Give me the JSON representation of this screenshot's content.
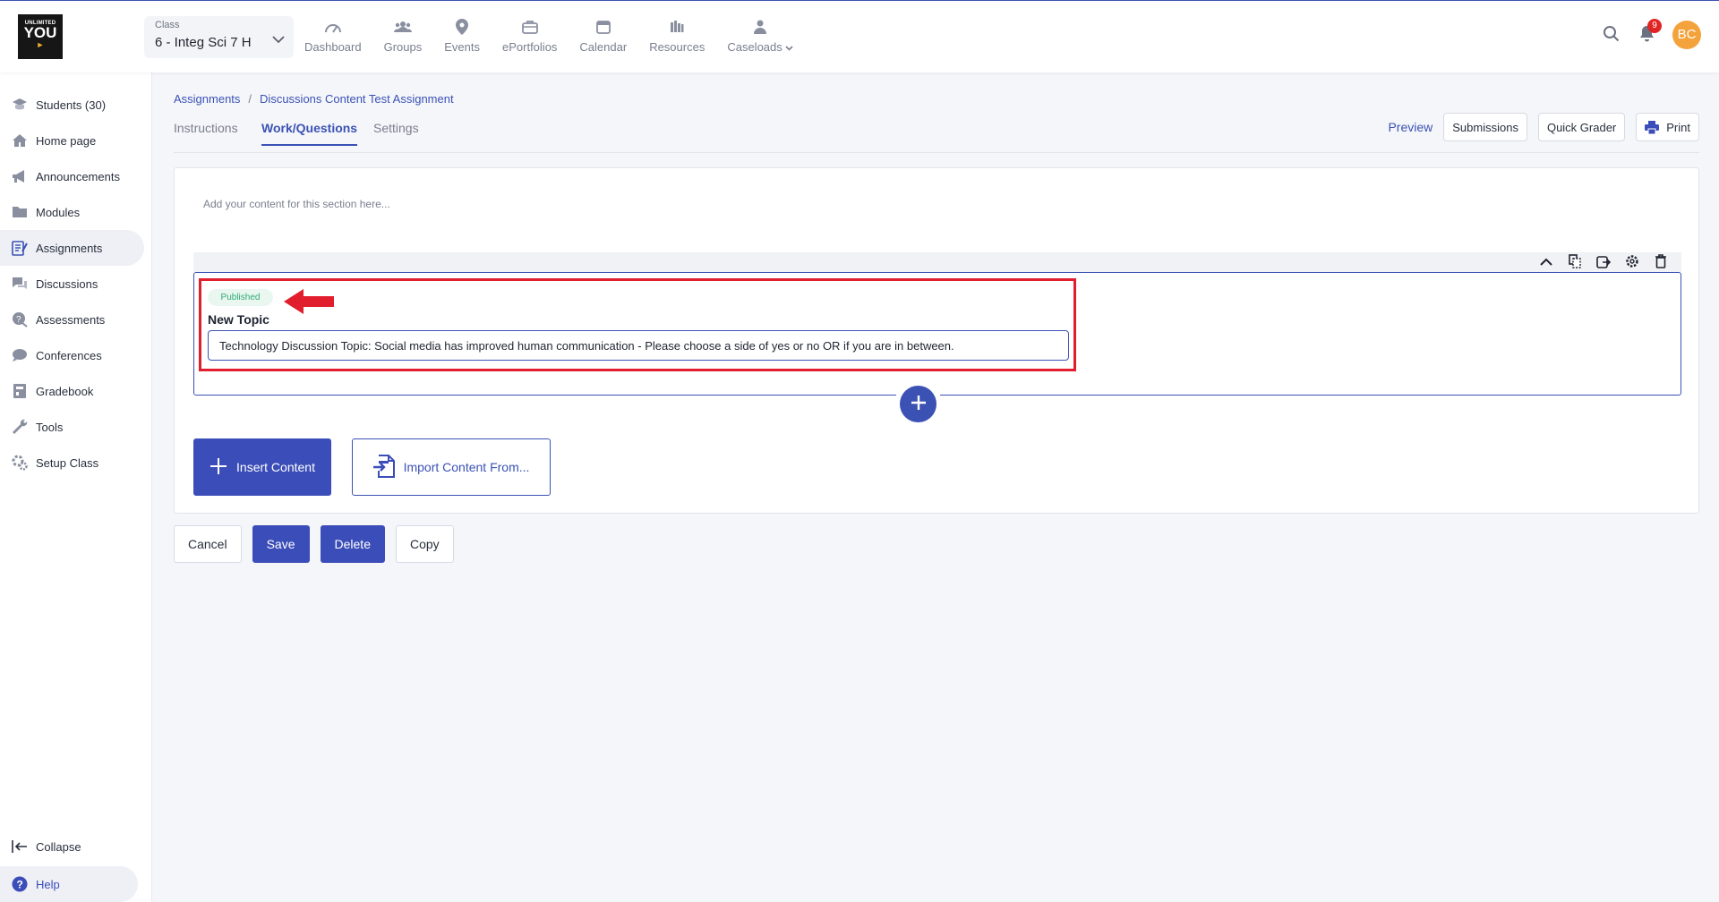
{
  "header": {
    "logo": {
      "line1": "UNLIMITED",
      "line2": "YOU"
    },
    "class_select": {
      "label": "Class",
      "value": "6 - Integ Sci 7 H"
    },
    "nav": [
      "Dashboard",
      "Groups",
      "Events",
      "ePortfolios",
      "Calendar",
      "Resources",
      "Caseloads"
    ],
    "notification_count": "9",
    "avatar_initials": "BC"
  },
  "sidebar": {
    "items": [
      {
        "label": "Students (30)",
        "icon": "students-icon"
      },
      {
        "label": "Home page",
        "icon": "home-icon"
      },
      {
        "label": "Announcements",
        "icon": "megaphone-icon"
      },
      {
        "label": "Modules",
        "icon": "folder-icon"
      },
      {
        "label": "Assignments",
        "icon": "assignment-icon",
        "active": true
      },
      {
        "label": "Discussions",
        "icon": "chat-icon"
      },
      {
        "label": "Assessments",
        "icon": "assessment-icon"
      },
      {
        "label": "Conferences",
        "icon": "conference-icon"
      },
      {
        "label": "Gradebook",
        "icon": "gradebook-icon"
      },
      {
        "label": "Tools",
        "icon": "wrench-icon"
      },
      {
        "label": "Setup Class",
        "icon": "gear-icon"
      }
    ],
    "collapse": "Collapse",
    "help": "Help"
  },
  "breadcrumb": {
    "root": "Assignments",
    "separator": "/",
    "current": "Discussions Content Test Assignment"
  },
  "tabs": [
    "Instructions",
    "Work/Questions",
    "Settings"
  ],
  "actions": {
    "preview": "Preview",
    "submissions": "Submissions",
    "quick_grader": "Quick Grader",
    "print": "Print"
  },
  "editor": {
    "placeholder": "Add your content for this section here...",
    "block": {
      "status": "Published",
      "title": "New Topic",
      "input_value": "Technology Discussion Topic: Social media has improved human communication - Please choose a side of yes or no OR if you are in between."
    },
    "insert_content": "Insert Content",
    "import_content": "Import Content From..."
  },
  "footer": {
    "cancel": "Cancel",
    "save": "Save",
    "delete": "Delete",
    "copy": "Copy"
  },
  "colors": {
    "primary": "#3b4db8",
    "accent_red": "#e01e2d",
    "published": "#2faa72",
    "avatar": "#f4a23b"
  }
}
